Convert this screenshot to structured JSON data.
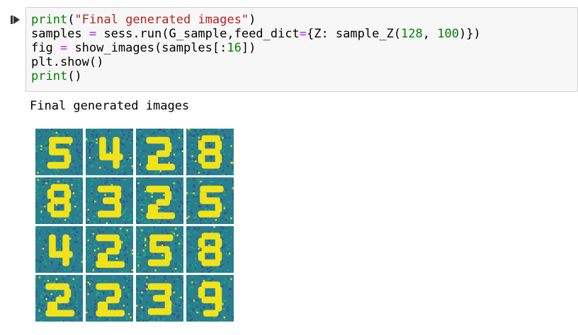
{
  "cell": {
    "code_lines": [
      [
        {
          "t": "print",
          "c": "kw"
        },
        {
          "t": "(",
          "c": ""
        },
        {
          "t": "\"Final generated images\"",
          "c": "str"
        },
        {
          "t": ")",
          "c": ""
        }
      ],
      [
        {
          "t": "samples ",
          "c": ""
        },
        {
          "t": "=",
          "c": "op"
        },
        {
          "t": " sess.run(G_sample,feed_dict",
          "c": ""
        },
        {
          "t": "=",
          "c": "op"
        },
        {
          "t": "{Z: sample_Z(",
          "c": ""
        },
        {
          "t": "128",
          "c": "num"
        },
        {
          "t": ", ",
          "c": ""
        },
        {
          "t": "100",
          "c": "num"
        },
        {
          "t": ")})",
          "c": ""
        }
      ],
      [
        {
          "t": "fig ",
          "c": ""
        },
        {
          "t": "=",
          "c": "op"
        },
        {
          "t": " show_images(samples[:",
          "c": ""
        },
        {
          "t": "16",
          "c": "num"
        },
        {
          "t": "])",
          "c": ""
        }
      ],
      [
        {
          "t": "plt.show()",
          "c": ""
        }
      ],
      [
        {
          "t": "print",
          "c": "kw"
        },
        {
          "t": "()",
          "c": ""
        }
      ]
    ]
  },
  "output": {
    "text": "Final generated images",
    "grid": {
      "rows": 4,
      "cols": 4,
      "digits": [
        "5",
        "4",
        "2",
        "8",
        "8",
        "3",
        "2",
        "5",
        "4",
        "2",
        "5",
        "8",
        "2",
        "2",
        "3",
        "9"
      ],
      "colors": {
        "bg": "#2a7f8e",
        "dark": "#3b4e8c",
        "mid": "#23a883",
        "bright": "#f2e21a"
      }
    }
  }
}
